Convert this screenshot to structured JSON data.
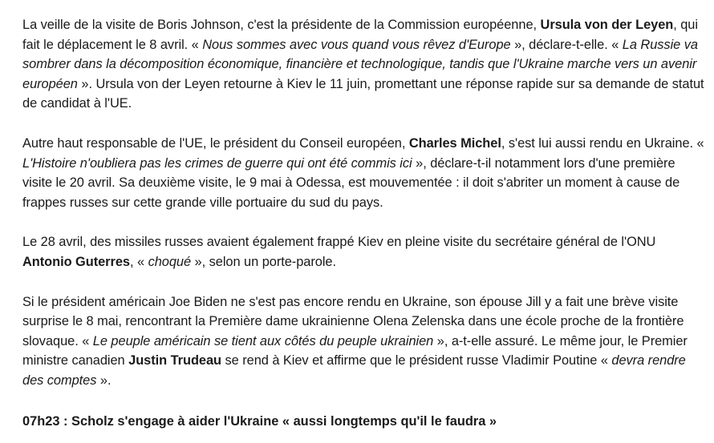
{
  "paragraphs": [
    {
      "segments": [
        {
          "style": "normal",
          "text": "La veille de la visite de Boris Johnson, c'est la présidente de la Commission européenne, "
        },
        {
          "style": "bold",
          "text": "Ursula von der Leyen"
        },
        {
          "style": "normal",
          "text": ", qui fait le déplacement le 8 avril. « "
        },
        {
          "style": "italic",
          "text": "Nous sommes avec vous quand vous rêvez d'Europe"
        },
        {
          "style": "normal",
          "text": " », déclare-t-elle. « "
        },
        {
          "style": "italic",
          "text": "La Russie va sombrer dans la décomposition économique, financière et technologique, tandis que l'Ukraine marche vers un avenir européen"
        },
        {
          "style": "normal",
          "text": " ». Ursula von der Leyen retourne à Kiev le 11 juin, promettant une réponse rapide sur sa demande de statut de candidat à l'UE."
        }
      ]
    },
    {
      "segments": [
        {
          "style": "normal",
          "text": "Autre haut responsable de l'UE, le président du Conseil européen, "
        },
        {
          "style": "bold",
          "text": "Charles Michel"
        },
        {
          "style": "normal",
          "text": ", s'est lui aussi rendu en Ukraine. « "
        },
        {
          "style": "italic",
          "text": "L'Histoire n'oubliera pas les crimes de guerre qui ont été commis ici"
        },
        {
          "style": "normal",
          "text": " », déclare-t-il notamment lors d'une première visite le 20 avril. Sa deuxième visite, le 9 mai à Odessa, est mouvementée : il doit s'abriter un moment à cause de frappes russes sur cette grande ville portuaire du sud du pays."
        }
      ]
    },
    {
      "segments": [
        {
          "style": "normal",
          "text": "Le 28 avril, des missiles russes avaient également frappé Kiev en pleine visite du secrétaire général de l'ONU "
        },
        {
          "style": "bold",
          "text": "Antonio Guterres"
        },
        {
          "style": "normal",
          "text": ", « "
        },
        {
          "style": "italic",
          "text": "choqué"
        },
        {
          "style": "normal",
          "text": " », selon un porte-parole."
        }
      ]
    },
    {
      "segments": [
        {
          "style": "normal",
          "text": "Si le président américain Joe Biden ne s'est pas encore rendu en Ukraine, son épouse Jill y a fait une brève visite surprise le 8 mai, rencontrant la Première dame ukrainienne Olena Zelenska dans une école proche de la frontière slovaque. « "
        },
        {
          "style": "italic",
          "text": "Le peuple américain se tient aux côtés du peuple ukrainien"
        },
        {
          "style": "normal",
          "text": " », a-t-elle assuré. Le même jour, le Premier ministre canadien "
        },
        {
          "style": "bold",
          "text": "Justin Trudeau"
        },
        {
          "style": "normal",
          "text": " se rend à Kiev et affirme que le président russe Vladimir Poutine « "
        },
        {
          "style": "italic",
          "text": "devra rendre des comptes"
        },
        {
          "style": "normal",
          "text": " »."
        }
      ]
    }
  ],
  "section_heading": "07h23 : Scholz s'engage à aider l'Ukraine « aussi longtemps qu'il le faudra »"
}
